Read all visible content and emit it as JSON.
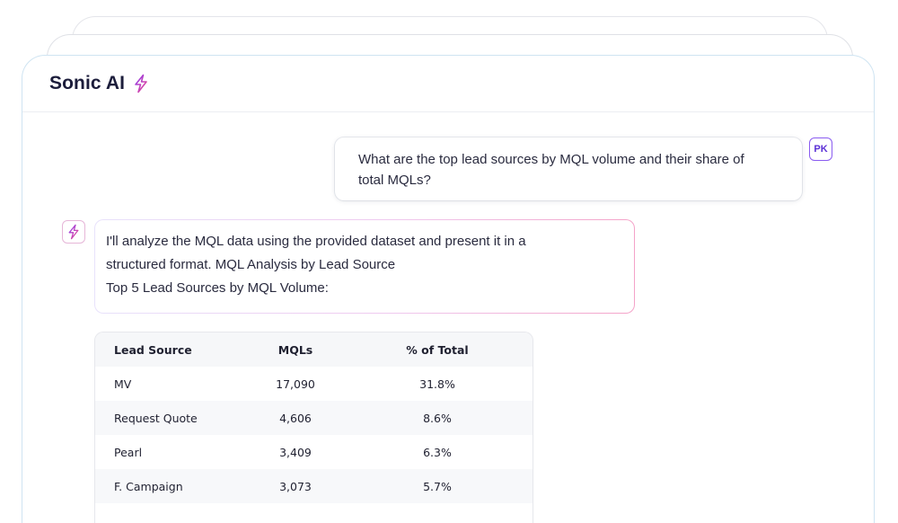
{
  "app": {
    "title": "Sonic AI",
    "title_icon": "lightning-bolt-icon"
  },
  "colors": {
    "accent_purple": "#7b3fe4",
    "accent_pink": "#ec4899",
    "card_border": "#cfe4f2"
  },
  "conversation": {
    "user": {
      "avatar_initials": "PK",
      "lines": [
        "What are the top lead sources by MQL volume and their share of",
        "total MQLs?"
      ]
    },
    "assistant": {
      "avatar_icon": "lightning-bolt-icon",
      "lines": [
        "I'll analyze the MQL data using the provided dataset and present it in a",
        "structured format. MQL Analysis by Lead Source",
        "Top 5 Lead Sources by MQL Volume:"
      ]
    }
  },
  "table": {
    "headers": [
      "Lead Source",
      "MQLs",
      "% of Total"
    ],
    "rows": [
      {
        "source": "MV",
        "mqls": "17,090",
        "pct": "31.8%"
      },
      {
        "source": "Request Quote",
        "mqls": "4,606",
        "pct": "8.6%"
      },
      {
        "source": "Pearl",
        "mqls": "3,409",
        "pct": "6.3%"
      },
      {
        "source": "F. Campaign",
        "mqls": "3,073",
        "pct": "5.7%"
      }
    ]
  }
}
